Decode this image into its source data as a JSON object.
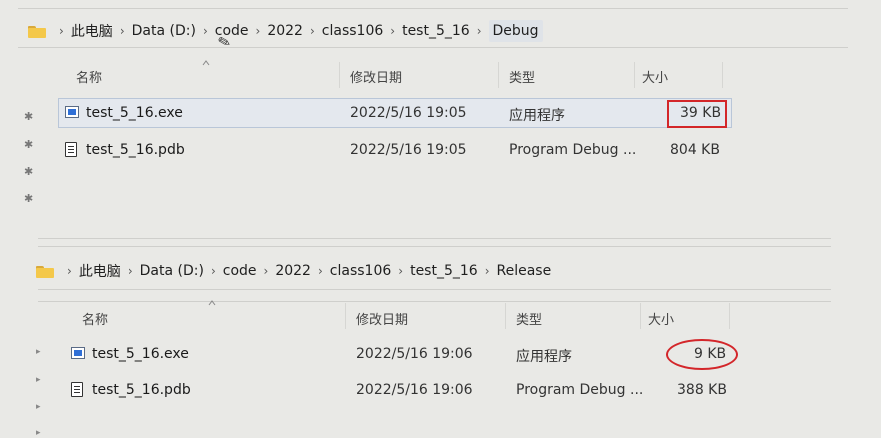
{
  "top": {
    "address": [
      "此电脑",
      "Data (D:)",
      "code",
      "2022",
      "class106",
      "test_5_16",
      "Debug"
    ],
    "columns": {
      "name": "名称",
      "modified": "修改日期",
      "type": "类型",
      "size": "大小"
    },
    "files": [
      {
        "name": "test_5_16.exe",
        "modified": "2022/5/16 19:05",
        "type": "应用程序",
        "size": "39 KB"
      },
      {
        "name": "test_5_16.pdb",
        "modified": "2022/5/16 19:05",
        "type": "Program Debug ...",
        "size": "804 KB"
      }
    ]
  },
  "bottom": {
    "address": [
      "此电脑",
      "Data (D:)",
      "code",
      "2022",
      "class106",
      "test_5_16",
      "Release"
    ],
    "columns": {
      "name": "名称",
      "modified": "修改日期",
      "type": "类型",
      "size": "大小"
    },
    "files": [
      {
        "name": "test_5_16.exe",
        "modified": "2022/5/16 19:06",
        "type": "应用程序",
        "size": "9 KB"
      },
      {
        "name": "test_5_16.pdb",
        "modified": "2022/5/16 19:06",
        "type": "Program Debug ...",
        "size": "388 KB"
      }
    ]
  },
  "icons": [
    "folder-icon",
    "pin-icon",
    "exe-icon",
    "pdb-icon",
    "pencil-cursor-icon",
    "chevron-right-icon"
  ],
  "colors": {
    "annotation": "#d3262a",
    "folder": "#f4c84a",
    "selection": "#e4e8ee",
    "background": "#e9e9e6"
  }
}
